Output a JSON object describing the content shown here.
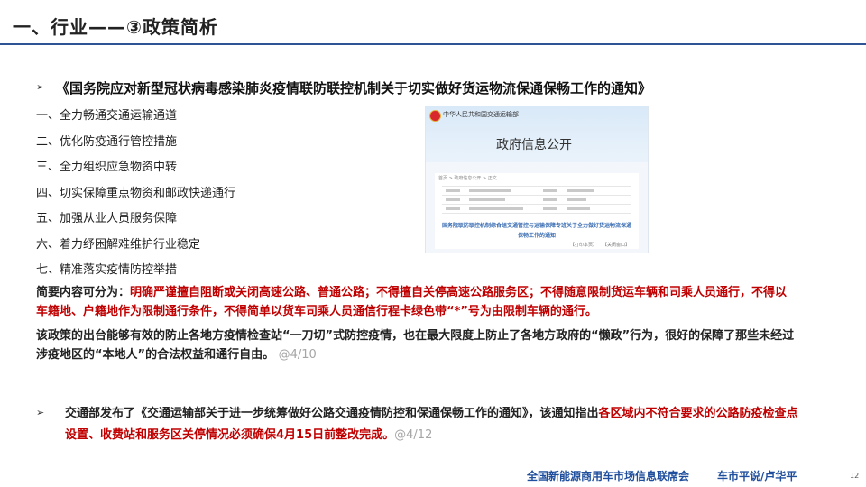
{
  "title": "一、行业——③政策简析",
  "section1": {
    "heading": "《国务院应对新型冠状病毒感染肺炎疫情联防联控机制关于切实做好货运物流保通保畅工作的通知》",
    "items": [
      "一、全力畅通交通运输通道",
      "二、优化防疫通行管控措施",
      "三、全力组织应急物资中转",
      "四、切实保障重点物资和邮政快递通行",
      "五、加强从业人员服务保障",
      "六、着力纾困解难维护行业稳定",
      "七、精准落实疫情防控举措"
    ],
    "summary_label": "简要内容可分为：",
    "summary_text": "明确严谨擅自阻断或关闭高速公路、普通公路；不得擅自关停高速公路服务区；不得随意限制货运车辆和司乘人员通行，不得以车籍地、户籍地作为限制通行条件，不得简单以货车司乘人员通信行程卡绿色带“*”号为由限制车辆的通行。",
    "para": "该政策的出台能够有效的防止各地方疫情检查站“一刀切”式防控疫情，也在最大限度上防止了各地方政府的“懒政”行为，很好的保障了那些未经过涉疫地区的“本地人”的合法权益和通行自由。",
    "para_date": "@4/10"
  },
  "section2": {
    "text_pre": "交通部发布了《交通运输部关于进一步统筹做好公路交通疫情防控和保通保畅工作的通知》，该通知指出",
    "text_red": "各区域内不符合要求的公路防疫检查点设置、收费站和服务区关停情况必须确保4月15日前整改完成。",
    "date": "@4/12"
  },
  "doc_image": {
    "ministry": "中华人民共和国交通运输部",
    "banner_title": "政府信息公开",
    "crumb": "首页 > 政府信息公开 > 正文",
    "heading": "国务院联防联控机制综合组交通管控与运输保障专班关于全力做好货运物流保通保畅工作的通知",
    "links": [
      "【打印本页】",
      "【关闭窗口】"
    ]
  },
  "footer": {
    "org": "全国新能源商用车市场信息联席会",
    "author": "车市平说/卢华平",
    "page": "12"
  },
  "colors": {
    "accent": "#2f5496",
    "red": "#c00000",
    "footer": "#1f4e9c"
  }
}
